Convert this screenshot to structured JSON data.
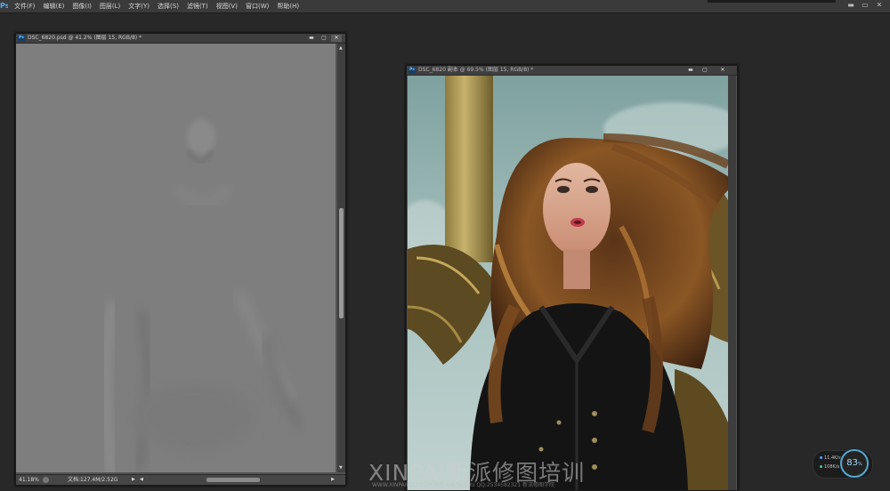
{
  "app": {
    "logo": "Ps"
  },
  "menu": {
    "items": [
      "文件(F)",
      "编辑(E)",
      "图像(I)",
      "图层(L)",
      "文字(Y)",
      "选择(S)",
      "滤镜(T)",
      "视图(V)",
      "窗口(W)",
      "帮助(H)"
    ]
  },
  "window_controls": {
    "minimize": "▬",
    "restore": "▭",
    "close": "✕"
  },
  "doc_left": {
    "title": "DSC_6820.psd @ 41.2% (图层 15, RGB/8) *",
    "zoom": "41.18%",
    "doc_size": "文档:127.4M/2.52G",
    "controls": {
      "minimize": "▬",
      "restore": "▢",
      "close": "✕"
    }
  },
  "doc_right": {
    "title": "DSC_6820 副本 @ 69.5% (图层 15, RGB/8) *",
    "controls": {
      "minimize": "▬",
      "restore": "▢",
      "close": "✕"
    }
  },
  "watermark": {
    "main": "XINPAI新派修图培训",
    "sub": "WWW.XINPAIEDU.COM  微信:XINPAIEDU  QQ:2534582321  新派修图学院"
  },
  "net_monitor": {
    "upload": "11.4K/s",
    "download": "108K/s",
    "percent": "83",
    "percent_unit": "%"
  },
  "colors": {
    "accent_blue": "#4fb0ff",
    "upload_dot": "#4fa3ff",
    "download_dot": "#47c98a",
    "gauge_ring": "#5aa7c9"
  }
}
